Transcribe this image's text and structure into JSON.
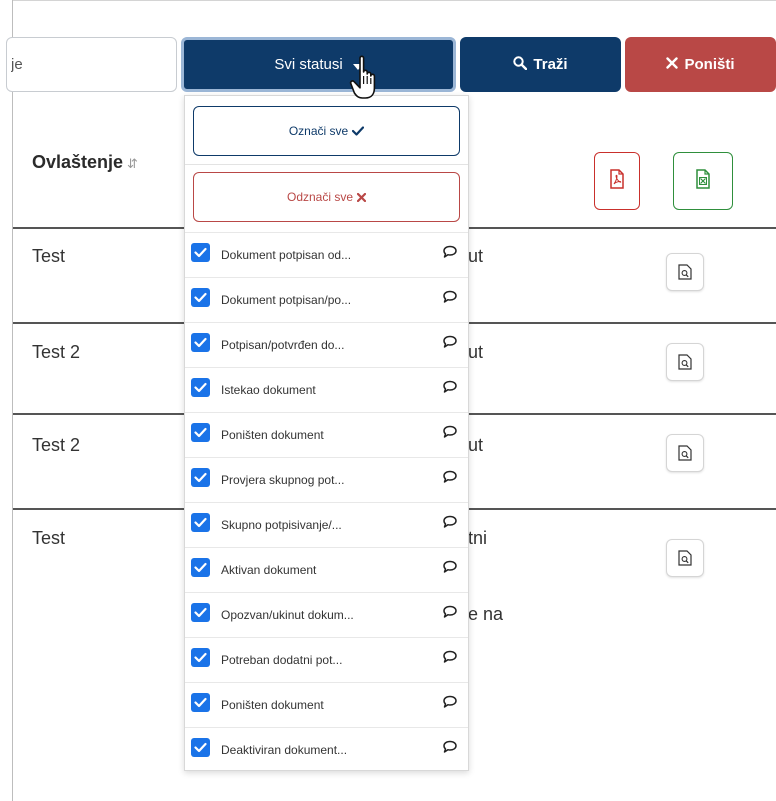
{
  "toolbar": {
    "search_value": "je",
    "status_button_label": "Svi statusi",
    "search_button_label": "Traži",
    "reset_button_label": "Poništi"
  },
  "table": {
    "column_header": "Ovlaštenje",
    "rows": [
      {
        "name": "Test",
        "fragment": "ut"
      },
      {
        "name": "Test 2",
        "fragment": "ut"
      },
      {
        "name": "Test 2",
        "fragment": "ut"
      },
      {
        "name": "Test",
        "fragment": "tni",
        "fragment2": "e na"
      }
    ]
  },
  "dropdown": {
    "select_all_label": "Označi sve",
    "deselect_all_label": "Odznači sve",
    "items": [
      {
        "label": "Dokument potpisan od...",
        "checked": true
      },
      {
        "label": "Dokument potpisan/po...",
        "checked": true
      },
      {
        "label": "Potpisan/potvrđen do...",
        "checked": true
      },
      {
        "label": "Istekao dokument",
        "checked": true
      },
      {
        "label": "Poništen dokument",
        "checked": true
      },
      {
        "label": "Provjera skupnog pot...",
        "checked": true
      },
      {
        "label": "Skupno potpisivanje/...",
        "checked": true
      },
      {
        "label": "Aktivan dokument",
        "checked": true
      },
      {
        "label": "Opozvan/ukinut dokum...",
        "checked": true
      },
      {
        "label": "Potreban dodatni pot...",
        "checked": true
      },
      {
        "label": "Poništen dokument",
        "checked": true
      },
      {
        "label": "Deaktiviran dokument...",
        "checked": true
      }
    ]
  },
  "colors": {
    "primary": "#0e3a69",
    "danger": "#b94846",
    "checkbox": "#1a73e8",
    "excel": "#2f8f3c",
    "pdf": "#c9302c"
  }
}
